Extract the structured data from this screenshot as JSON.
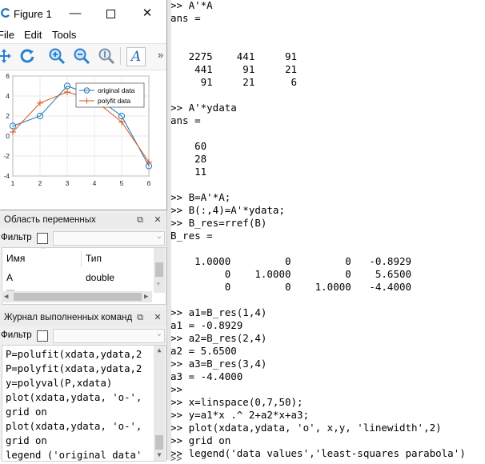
{
  "figure": {
    "title": "Figure 1",
    "menu": [
      "File",
      "Edit",
      "Tools"
    ],
    "toolbar_more": "»",
    "plot": {
      "chart_data": {
        "type": "line",
        "x": [
          1,
          2,
          3,
          4,
          5,
          6
        ],
        "xlim": [
          1,
          6
        ],
        "ylim": [
          -4,
          6
        ],
        "xticks": [
          "1",
          "2",
          "3",
          "4",
          "5",
          "6"
        ],
        "yticks": [
          "6",
          "4",
          "2",
          "0",
          "-2",
          "-4"
        ],
        "grid": true,
        "legend_position": "top-right",
        "series": [
          {
            "name": "original data",
            "values": [
              1,
              2,
              5,
              4,
              2,
              -3
            ],
            "marker": "o",
            "color": "#1f77b4"
          },
          {
            "name": "polyfit data",
            "values": [
              0.4,
              3.3,
              4.4,
              3.6,
              1.4,
              -2.6
            ],
            "marker": "+",
            "color": "#d95319"
          }
        ]
      }
    }
  },
  "workspace": {
    "title": "Область переменных",
    "filter_label": "Фильтр",
    "columns": [
      "Имя",
      "Тип"
    ],
    "rows": [
      {
        "name": "A",
        "type": "double"
      }
    ]
  },
  "history": {
    "title": "Журнал выполненных команд",
    "filter_label": "Фильтр",
    "lines": [
      "P=polufit(xdata,ydata,2",
      "P=polyfit(xdata,ydata,2",
      "y=polyval(P,xdata)",
      "plot(xdata,ydata, 'o-',",
      "grid on",
      "plot(xdata,ydata, 'o-',",
      "grid on",
      "legend ('original data'"
    ]
  },
  "command_window": {
    "lines": [
      ">> A'*A",
      "ans =",
      "",
      "",
      "   2275    441     91",
      "    441     91     21",
      "     91     21      6",
      "",
      ">> A'*ydata",
      "ans =",
      "",
      "    60",
      "    28",
      "    11",
      "",
      ">> B=A'*A;",
      ">> B(:,4)=A'*ydata;",
      ">> B_res=rref(B)",
      "B_res =",
      "",
      "    1.0000         0         0   -0.8929",
      "         0    1.0000         0    5.6500",
      "         0         0    1.0000   -4.4000",
      "",
      ">> a1=B_res(1,4)",
      "a1 = -0.8929",
      ">> a2=B_res(2,4)",
      "a2 = 5.6500",
      ">> a3=B_res(3,4)",
      "a3 = -4.4000",
      ">>",
      ">> x=linspace(0,7,50);",
      ">> y=a1*x .^ 2+a2*x+a3;",
      ">> plot(xdata,ydata, 'o', x,y, 'linewidth',2)",
      ">> grid on",
      ">> legend('data values','least-squares parabola')"
    ],
    "prompt_caret": ">>"
  }
}
